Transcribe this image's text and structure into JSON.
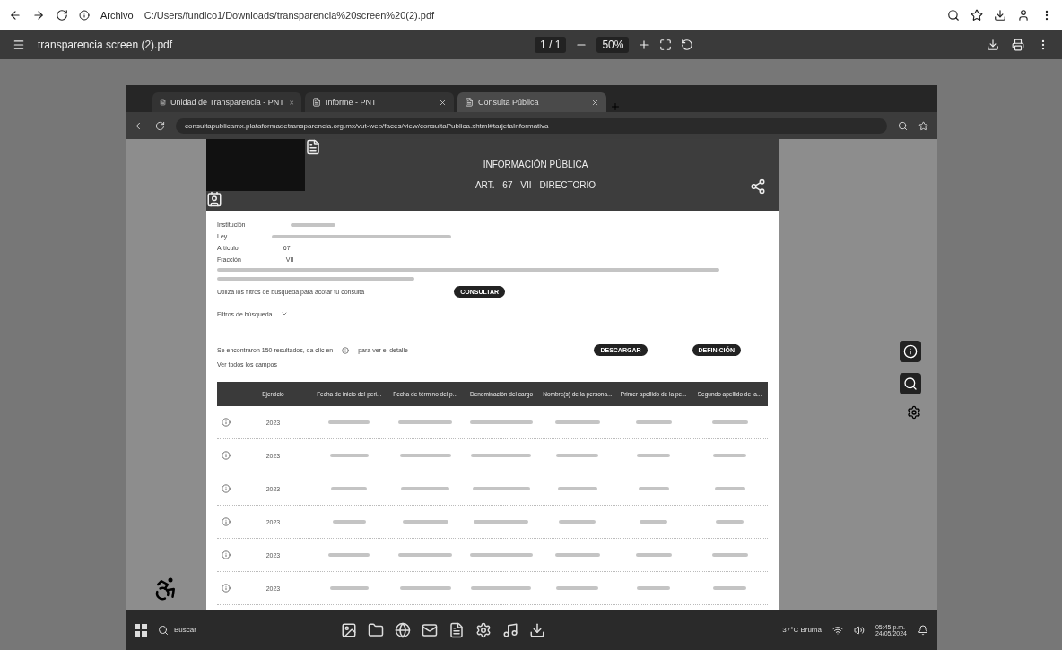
{
  "address_bar": {
    "label": "Archivo",
    "url": "C:/Users/fundico1/Downloads/transparencia%20screen%20(2).pdf"
  },
  "pdf_toolbar": {
    "filename": "transparencia screen (2).pdf",
    "page": "1 / 1",
    "zoom": "50%"
  },
  "embedded_screenshot": {
    "tabs": [
      {
        "title": "Unidad de Transparencia - PNT",
        "selected": false
      },
      {
        "title": "Informe - PNT",
        "selected": false
      },
      {
        "title": "Consulta Pública",
        "selected": true
      }
    ],
    "url": "consultapublicamx.plataformadetransparencia.org.mx/vut-web/faces/view/consultaPublica.xhtml#tarjetaInformativa",
    "header": {
      "menu": "INFORMACIÓN PÚBLICA",
      "section": "ART. - 67 - VII - DIRECTORIO"
    },
    "details": [
      {
        "label": "Institución"
      },
      {
        "label": "Ley"
      },
      {
        "label": "Artículo",
        "value": "67"
      },
      {
        "label": "Fracción",
        "value": "VII"
      }
    ],
    "filter_hint": "Utiliza los filtros de búsqueda para acotar tu consulta",
    "consult_button": "CONSULTAR",
    "filters_toggle": "Filtros de búsqueda",
    "results_before": "Se encontraron 150 resultados, da clic en",
    "results_after": "para ver el detalle",
    "download_button": "DESCARGAR",
    "definition_button": "DEFINICIÓN",
    "all_fields": "Ver todos los campos",
    "table": {
      "columns": [
        "Ejercicio",
        "Fecha de inicio del peri...",
        "Fecha de término del p...",
        "Denominación del cargo",
        "Nombre(s) de la persona...",
        "Primer apellido de la pe...",
        "Segundo apellido de la..."
      ],
      "rows": [
        {
          "year": "2023"
        },
        {
          "year": "2023"
        },
        {
          "year": "2023"
        },
        {
          "year": "2023"
        },
        {
          "year": "2023"
        },
        {
          "year": "2023"
        }
      ]
    },
    "taskbar": {
      "search": "Buscar",
      "weather": "37°C Bruma",
      "time": "05:45 p.m.",
      "date": "24/05/2024"
    }
  }
}
